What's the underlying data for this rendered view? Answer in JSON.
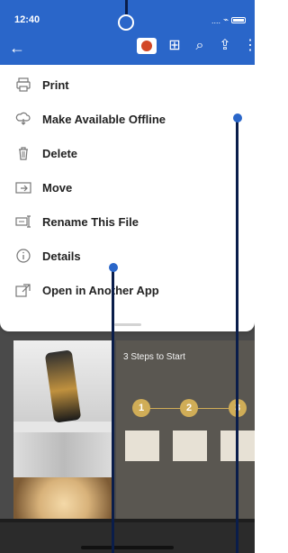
{
  "status": {
    "time": "12:40"
  },
  "toolbar": {
    "back_icon": "back-arrow-icon",
    "app_icon": "powerpoint-icon",
    "grid_icon": "grid-icon",
    "search_icon": "search-icon",
    "share_icon": "share-icon",
    "more_icon": "more-icon"
  },
  "menu": {
    "items": [
      {
        "label": "Print",
        "icon": "print-icon"
      },
      {
        "label": "Make Available Offline",
        "icon": "cloud-icon"
      },
      {
        "label": "Delete",
        "icon": "trash-icon"
      },
      {
        "label": "Move",
        "icon": "move-icon"
      },
      {
        "label": "Rename This File",
        "icon": "rename-icon"
      },
      {
        "label": "Details",
        "icon": "info-icon"
      },
      {
        "label": "Open in Another App",
        "icon": "open-external-icon"
      }
    ]
  },
  "slide": {
    "title": "3 Steps to Start",
    "steps": [
      "1",
      "2",
      "3"
    ]
  },
  "colors": {
    "accent": "#2a66c9",
    "annotation_line": "#0a1d4a",
    "step_gold": "#d0ad57"
  }
}
